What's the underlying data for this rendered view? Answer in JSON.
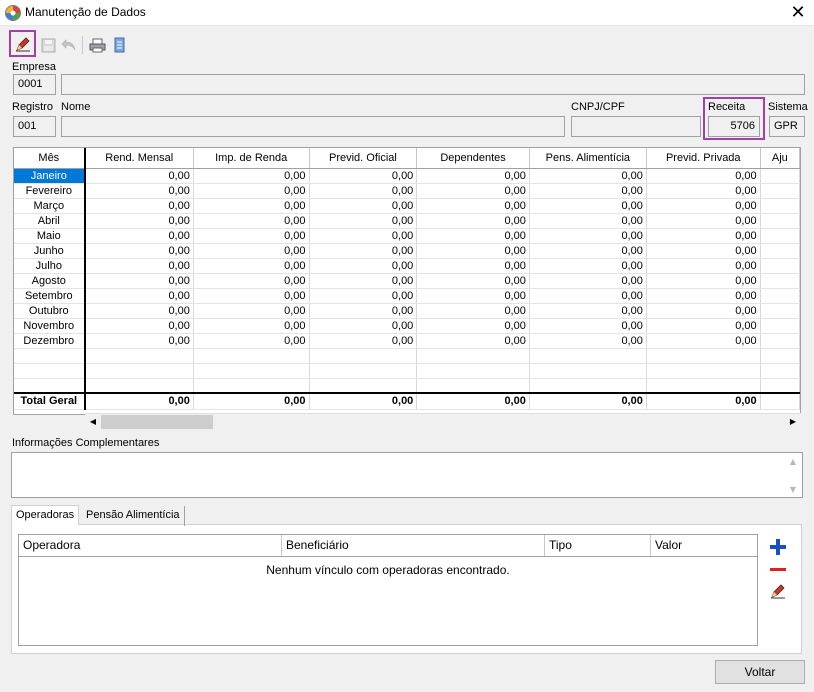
{
  "window": {
    "title": "Manutenção de Dados"
  },
  "toolbar": {
    "icons": [
      "edit-icon",
      "save-icon",
      "undo-icon",
      "print-icon",
      "document-icon"
    ]
  },
  "header": {
    "empresa_label": "Empresa",
    "empresa_code": "0001",
    "empresa_name": "",
    "registro_label": "Registro",
    "registro_value": "001",
    "nome_label": "Nome",
    "nome_value": "",
    "cnpj_label": "CNPJ/CPF",
    "cnpj_value": "",
    "receita_label": "Receita",
    "receita_value": "5706",
    "sistema_label": "Sistema",
    "sistema_value": "GPR"
  },
  "grid": {
    "columns": [
      "Mês",
      "Rend. Mensal",
      "Imp. de Renda",
      "Previd. Oficial",
      "Dependentes",
      "Pens. Alimentícia",
      "Previd. Privada",
      "Aju"
    ],
    "rows": [
      {
        "month": "Janeiro",
        "values": [
          "0,00",
          "0,00",
          "0,00",
          "0,00",
          "0,00",
          "0,00"
        ]
      },
      {
        "month": "Fevereiro",
        "values": [
          "0,00",
          "0,00",
          "0,00",
          "0,00",
          "0,00",
          "0,00"
        ]
      },
      {
        "month": "Março",
        "values": [
          "0,00",
          "0,00",
          "0,00",
          "0,00",
          "0,00",
          "0,00"
        ]
      },
      {
        "month": "Abril",
        "values": [
          "0,00",
          "0,00",
          "0,00",
          "0,00",
          "0,00",
          "0,00"
        ]
      },
      {
        "month": "Maio",
        "values": [
          "0,00",
          "0,00",
          "0,00",
          "0,00",
          "0,00",
          "0,00"
        ]
      },
      {
        "month": "Junho",
        "values": [
          "0,00",
          "0,00",
          "0,00",
          "0,00",
          "0,00",
          "0,00"
        ]
      },
      {
        "month": "Julho",
        "values": [
          "0,00",
          "0,00",
          "0,00",
          "0,00",
          "0,00",
          "0,00"
        ]
      },
      {
        "month": "Agosto",
        "values": [
          "0,00",
          "0,00",
          "0,00",
          "0,00",
          "0,00",
          "0,00"
        ]
      },
      {
        "month": "Setembro",
        "values": [
          "0,00",
          "0,00",
          "0,00",
          "0,00",
          "0,00",
          "0,00"
        ]
      },
      {
        "month": "Outubro",
        "values": [
          "0,00",
          "0,00",
          "0,00",
          "0,00",
          "0,00",
          "0,00"
        ]
      },
      {
        "month": "Novembro",
        "values": [
          "0,00",
          "0,00",
          "0,00",
          "0,00",
          "0,00",
          "0,00"
        ]
      },
      {
        "month": "Dezembro",
        "values": [
          "0,00",
          "0,00",
          "0,00",
          "0,00",
          "0,00",
          "0,00"
        ]
      }
    ],
    "total": {
      "label": "Total Geral",
      "values": [
        "0,00",
        "0,00",
        "0,00",
        "0,00",
        "0,00",
        "0,00"
      ]
    },
    "selected_color": "#0078d7"
  },
  "complementares": {
    "label": "Informações Complementares",
    "value": ""
  },
  "tabs": [
    {
      "label": "Operadoras",
      "active": true
    },
    {
      "label": "Pensão Alimentícia",
      "active": false
    }
  ],
  "operadoras": {
    "columns": [
      "Operadora",
      "Beneficiário",
      "Tipo",
      "Valor"
    ],
    "empty_message": "Nenhum vínculo com operadoras encontrado.",
    "side_buttons": [
      "add-icon",
      "remove-icon",
      "edit-icon"
    ]
  },
  "footer": {
    "voltar_label": "Voltar"
  },
  "colors": {
    "highlight": "#a040a8",
    "add": "#1a4fc4",
    "remove": "#e02020"
  }
}
